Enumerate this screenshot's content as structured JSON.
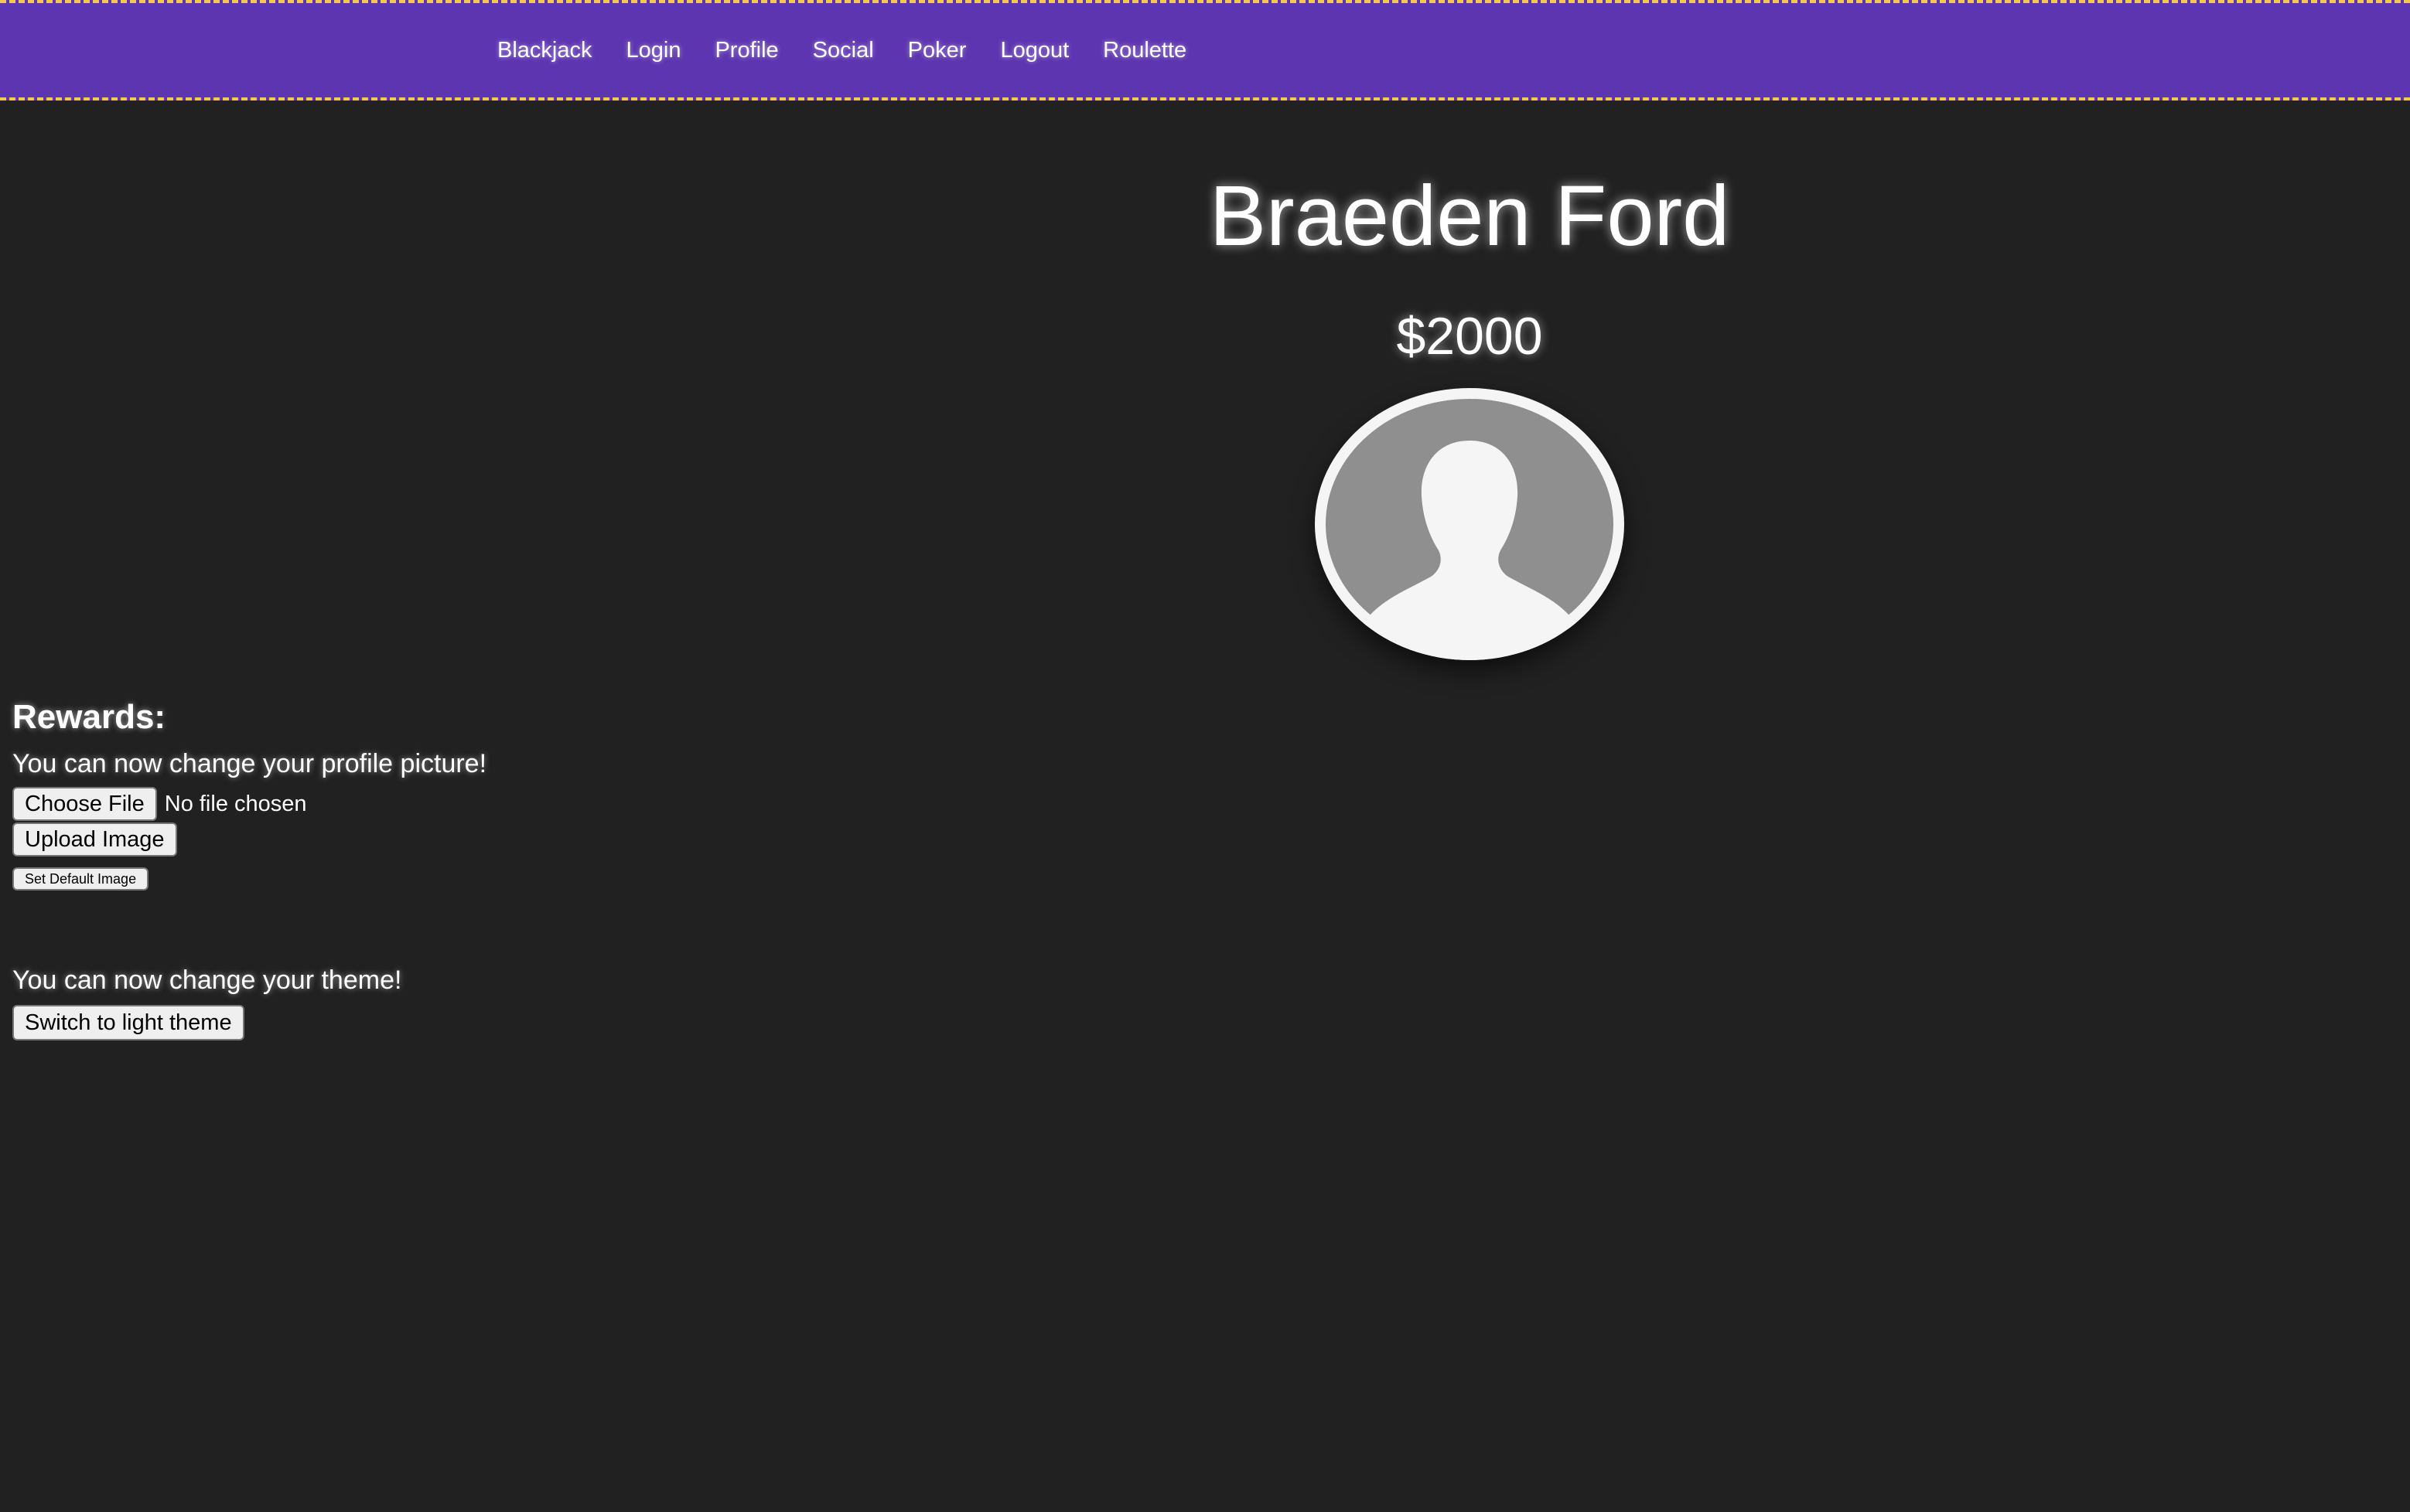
{
  "nav": {
    "items": [
      {
        "label": "Blackjack"
      },
      {
        "label": "Login"
      },
      {
        "label": "Profile"
      },
      {
        "label": "Social"
      },
      {
        "label": "Poker"
      },
      {
        "label": "Logout"
      },
      {
        "label": "Roulette"
      }
    ]
  },
  "profile": {
    "name": "Braeden Ford",
    "balance": "$2000",
    "avatar_icon": "user-silhouette-icon"
  },
  "rewards": {
    "title": "Rewards:",
    "picture_message": "You can now change your profile picture!",
    "choose_file_label": "Choose File",
    "file_status": "No file chosen",
    "upload_label": "Upload Image",
    "default_image_label": "Set Default Image",
    "theme_message": "You can now change your theme!",
    "theme_button_label": "Switch to light theme"
  },
  "colors": {
    "background": "#212121",
    "navbar": "#5e35b1",
    "navbar_border": "#f2c94c",
    "text": "#ffffff",
    "avatar_bg": "#f5f5f5",
    "avatar_figure": "#8f8f8f"
  }
}
